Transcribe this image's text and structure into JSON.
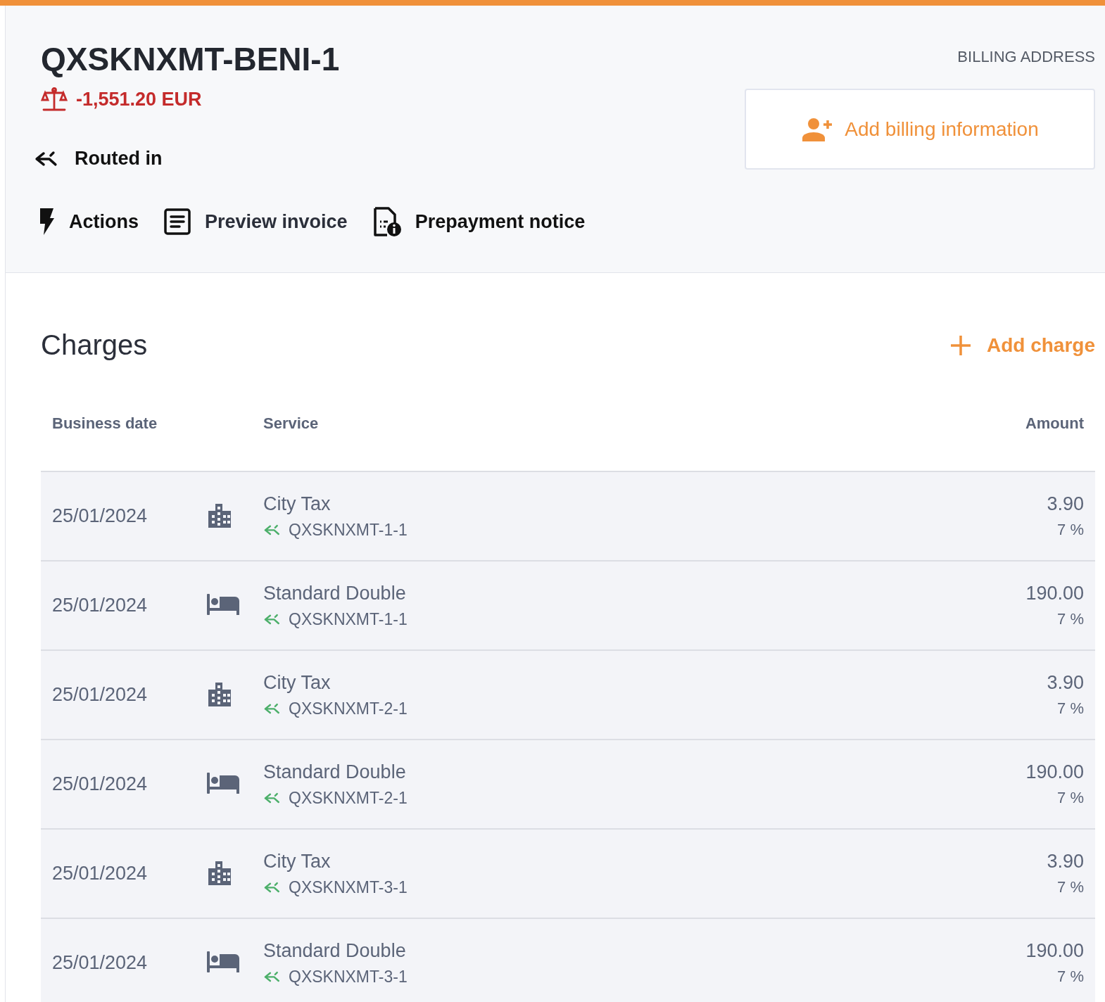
{
  "folio": {
    "title": "QXSKNXMT-BENI-1",
    "balance": "-1,551.20 EUR",
    "routing": "Routed in"
  },
  "billing": {
    "label": "BILLING ADDRESS",
    "button": "Add billing information"
  },
  "actions": [
    {
      "kind": "actions",
      "label": "Actions"
    },
    {
      "kind": "preview",
      "label": "Preview invoice"
    },
    {
      "kind": "prepayment",
      "label": "Prepayment notice"
    }
  ],
  "charges": {
    "title": "Charges",
    "add": "Add charge",
    "columns": [
      "Business date",
      "Service",
      "Amount"
    ],
    "rows": [
      {
        "date": "25/01/2024",
        "kind": "tax",
        "service": "City Tax",
        "source": "QXSKNXMT-1-1",
        "amount": "3.90",
        "vat": "7 %"
      },
      {
        "date": "25/01/2024",
        "kind": "room",
        "service": "Standard Double",
        "source": "QXSKNXMT-1-1",
        "amount": "190.00",
        "vat": "7 %"
      },
      {
        "date": "25/01/2024",
        "kind": "tax",
        "service": "City Tax",
        "source": "QXSKNXMT-2-1",
        "amount": "3.90",
        "vat": "7 %"
      },
      {
        "date": "25/01/2024",
        "kind": "room",
        "service": "Standard Double",
        "source": "QXSKNXMT-2-1",
        "amount": "190.00",
        "vat": "7 %"
      },
      {
        "date": "25/01/2024",
        "kind": "tax",
        "service": "City Tax",
        "source": "QXSKNXMT-3-1",
        "amount": "3.90",
        "vat": "7 %"
      },
      {
        "date": "25/01/2024",
        "kind": "room",
        "service": "Standard Double",
        "source": "QXSKNXMT-3-1",
        "amount": "190.00",
        "vat": "7 %"
      }
    ]
  }
}
